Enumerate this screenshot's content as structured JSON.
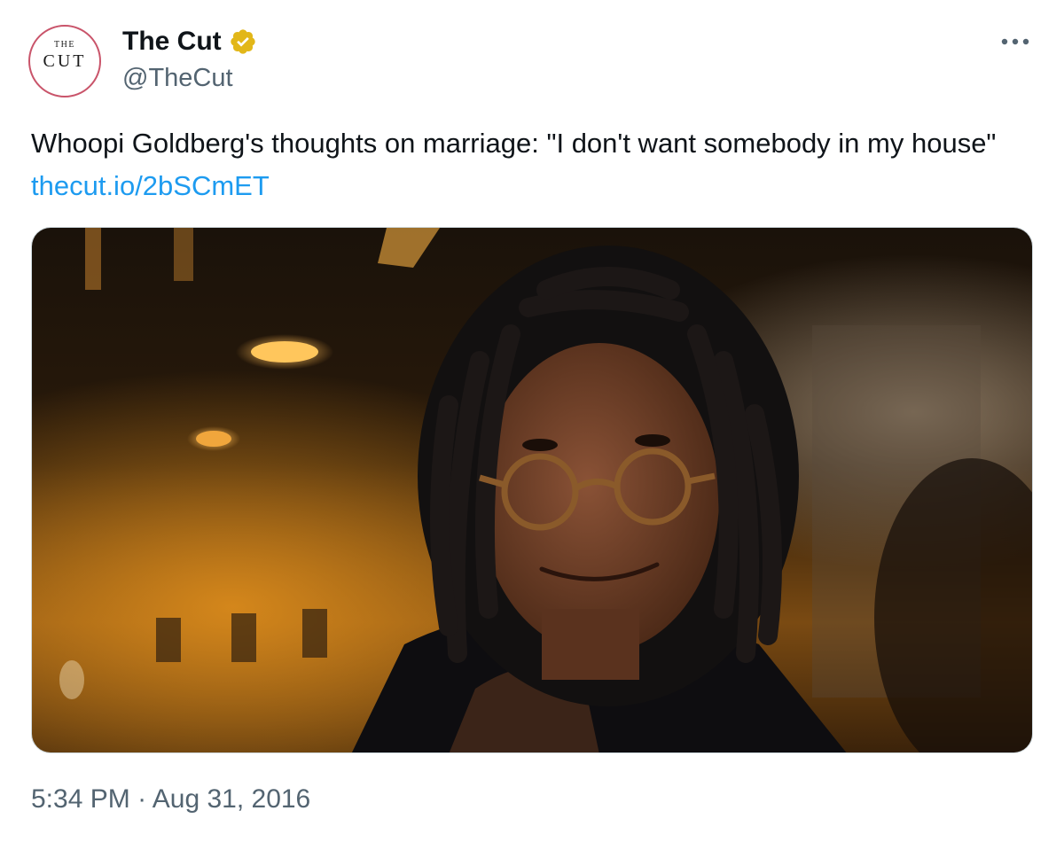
{
  "account": {
    "avatar_logo_top": "THE",
    "avatar_logo_main": "CUT",
    "display_name": "The Cut",
    "handle": "@TheCut",
    "verified_badge_color": "#e2b719"
  },
  "tweet": {
    "text": "Whoopi Goldberg's thoughts on marriage: \"I don't want somebody in my house\" ",
    "link_text": "thecut.io/2bSCmET",
    "link_color": "#1d9bf0",
    "timestamp_time": "5:34 PM",
    "timestamp_separator": " · ",
    "timestamp_date": "Aug 31, 2016"
  },
  "icons": {
    "more": "more-horizontal-icon",
    "verified": "verified-badge-icon"
  }
}
